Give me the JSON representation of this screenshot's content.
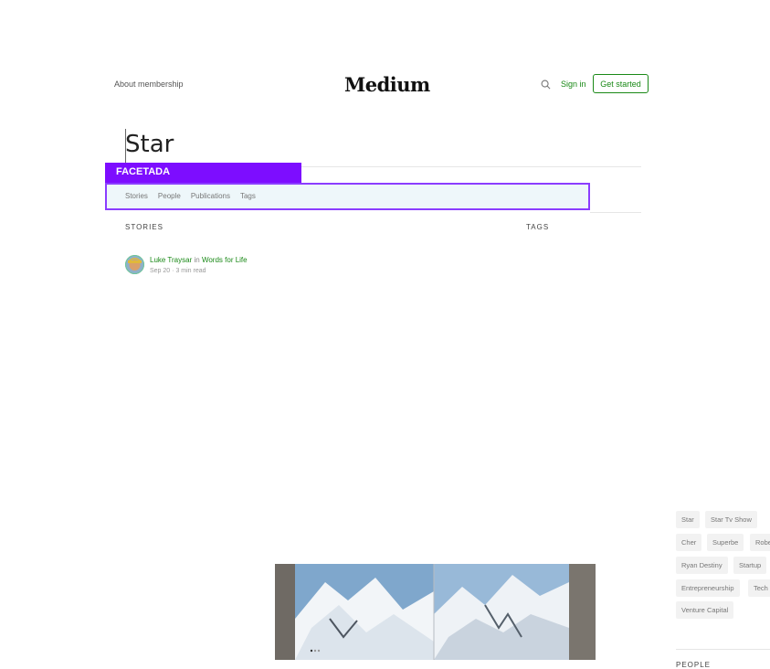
{
  "header": {
    "about_label": "About membership",
    "logo": "Medium",
    "search_icon": "search-icon",
    "signin_label": "Sign in",
    "get_started_label": "Get started"
  },
  "search": {
    "query": "Star"
  },
  "overlay_label": "FACETADA",
  "tabs": [
    "Stories",
    "People",
    "Publications",
    "Tags"
  ],
  "stories_section": {
    "heading": "STORIES",
    "story": {
      "author": "Luke Traysar",
      "in_word": "in",
      "publication": "Words for Life",
      "date": "Sep 20",
      "read_time": "3 min read"
    }
  },
  "tags_section": {
    "heading": "TAGS",
    "tags": [
      "Star",
      "Star Tv Show",
      "Cher",
      "Superbe",
      "Robes",
      "Ryan Destiny",
      "Startup",
      "Entrepreneurship",
      "Tech",
      "Venture Capital"
    ]
  },
  "people_section": {
    "heading": "PEOPLE"
  },
  "colors": {
    "accent_green": "#1a8917",
    "overlay_purple": "#7d0dff"
  }
}
